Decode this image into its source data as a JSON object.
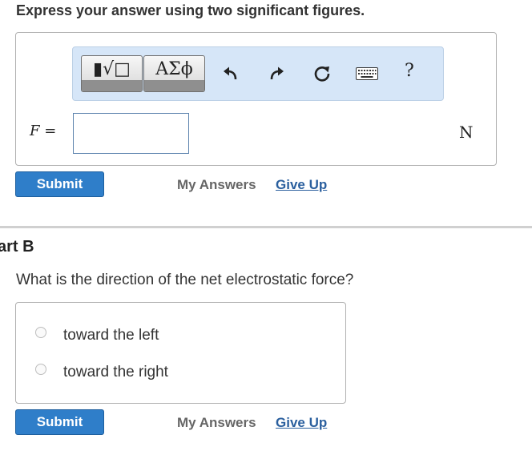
{
  "instruction": "Express your answer using two significant figures.",
  "toolbar": {
    "templates_glyph": "▮√□",
    "symbols_glyph": "ΑΣϕ",
    "help_label": "?",
    "icons": [
      "undo-icon",
      "redo-icon",
      "reset-icon",
      "keyboard-icon"
    ]
  },
  "answer": {
    "variable": "F",
    "equals": "=",
    "value": "",
    "unit": "N"
  },
  "part_a_actions": {
    "submit": "Submit",
    "my_answers": "My Answers",
    "give_up": "Give Up"
  },
  "part_b": {
    "title": "art B",
    "question": "What is the direction of the net electrostatic force?",
    "choices": [
      "toward the left",
      "toward the right"
    ],
    "submit": "Submit",
    "my_answers": "My Answers",
    "give_up": "Give Up"
  },
  "colors": {
    "primary_button": "#2f7ec9",
    "link": "#2a5f9e",
    "toolbar_bg": "#d6e6f8"
  }
}
